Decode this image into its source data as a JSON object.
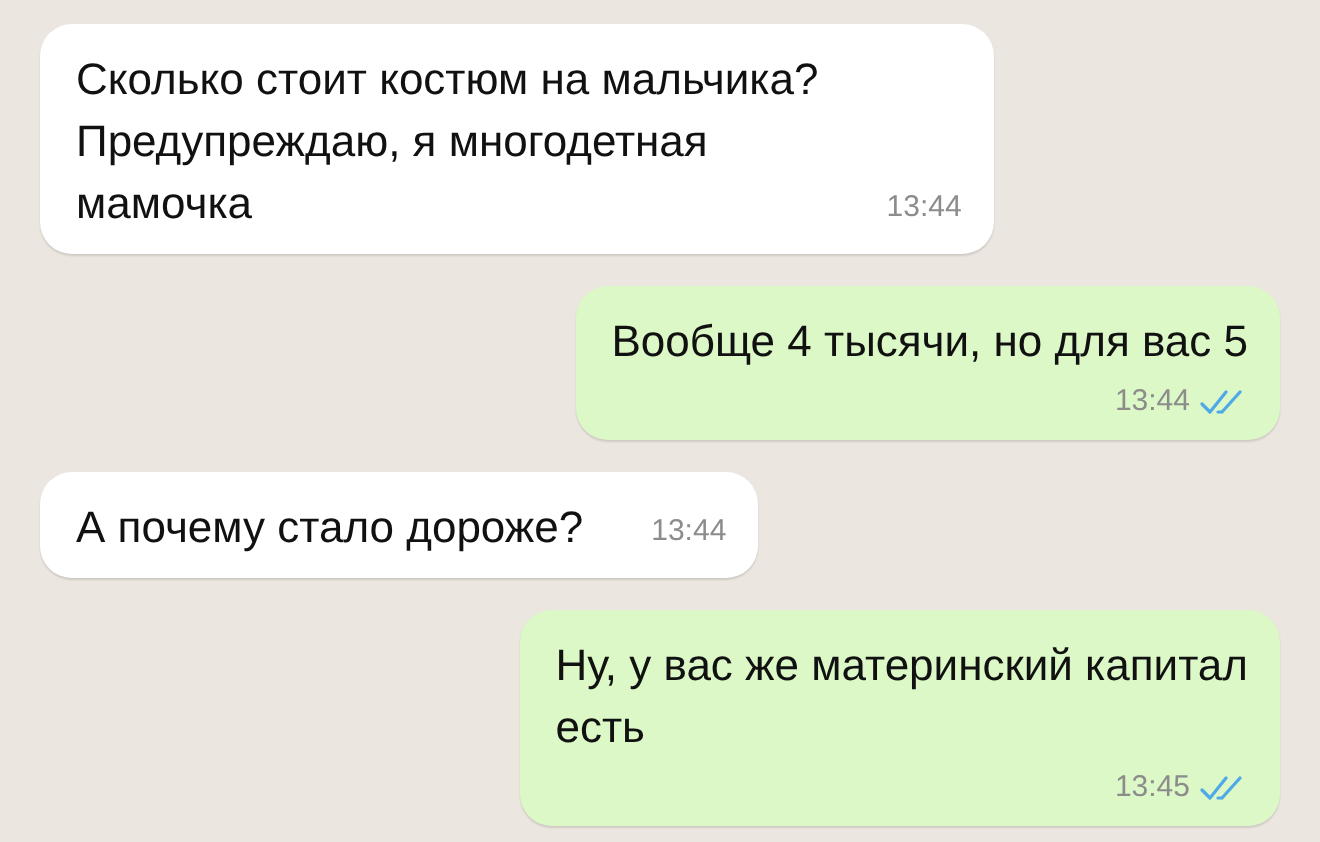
{
  "messages": [
    {
      "kind": "incoming",
      "text": "Сколько стоит костюм на мальчика?\nПредупреждаю, я многодетная\nмамочка",
      "time": "13:44"
    },
    {
      "kind": "outgoing",
      "text": "Вообще 4 тысячи, но для вас 5",
      "time": "13:44",
      "read": true
    },
    {
      "kind": "incoming",
      "text": "А почему стало дороже?",
      "time": "13:44"
    },
    {
      "kind": "outgoing",
      "text": "Ну, у вас же материнский капитал\nесть",
      "time": "13:45",
      "read": true
    }
  ]
}
